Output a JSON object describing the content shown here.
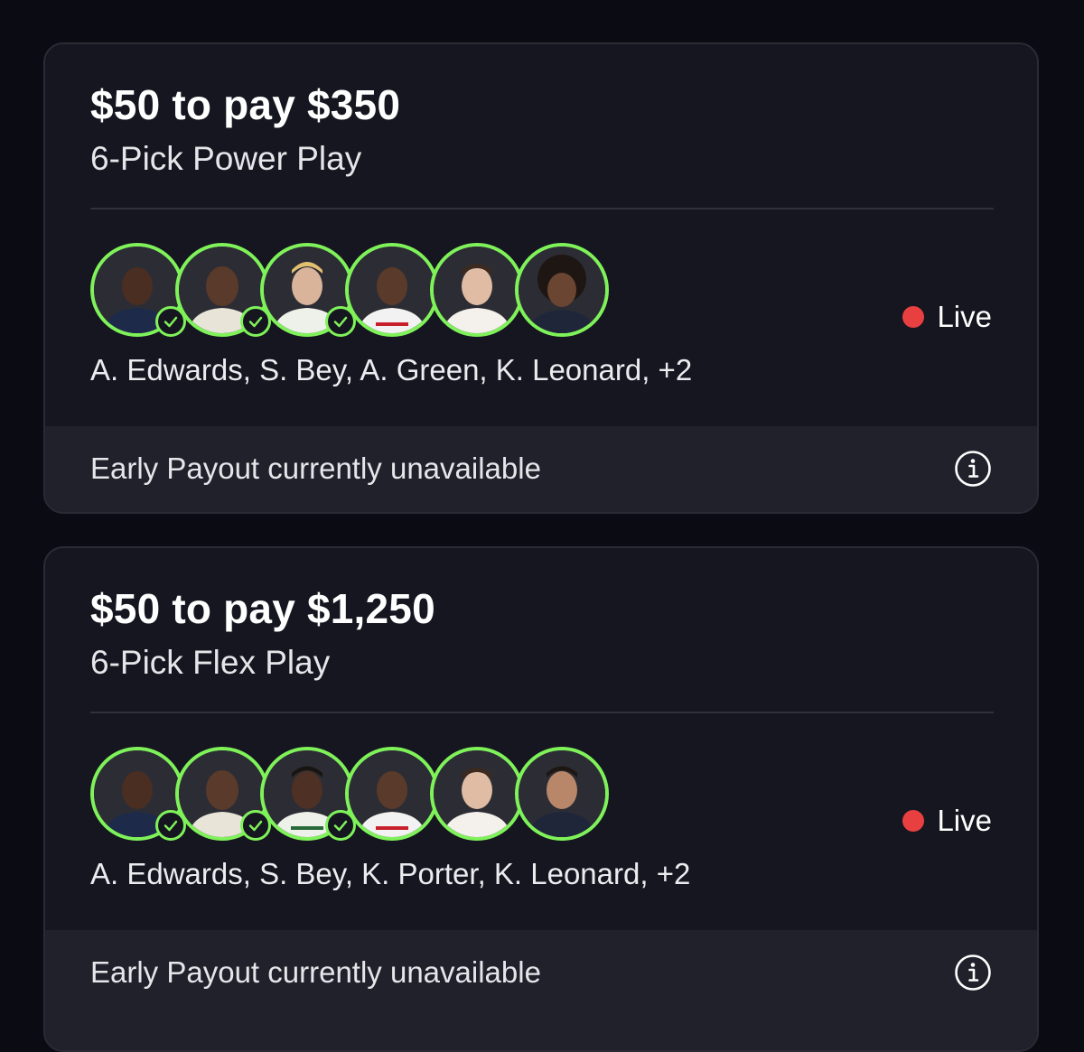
{
  "colors": {
    "background": "#0b0c13",
    "card": "#15161f",
    "accent_green": "#7ff25a",
    "live_red": "#e84040"
  },
  "entries": [
    {
      "title": "$50 to pay $350",
      "subtitle": "6-Pick Power Play",
      "status": "Live",
      "players_summary": "A. Edwards, S. Bey, A. Green, K. Leonard, +2",
      "footer_text": "Early Payout currently unavailable",
      "avatars": [
        {
          "icon": "player-avatar",
          "checked": true
        },
        {
          "icon": "player-avatar",
          "checked": true
        },
        {
          "icon": "player-avatar",
          "checked": true
        },
        {
          "icon": "player-avatar",
          "checked": false
        },
        {
          "icon": "player-avatar",
          "checked": false
        },
        {
          "icon": "player-avatar",
          "checked": false
        }
      ]
    },
    {
      "title": "$50 to pay $1,250",
      "subtitle": "6-Pick Flex Play",
      "status": "Live",
      "players_summary": "A. Edwards, S. Bey, K. Porter, K. Leonard, +2",
      "footer_text": "Early Payout currently unavailable",
      "avatars": [
        {
          "icon": "player-avatar",
          "checked": true
        },
        {
          "icon": "player-avatar",
          "checked": true
        },
        {
          "icon": "player-avatar",
          "checked": true
        },
        {
          "icon": "player-avatar",
          "checked": false
        },
        {
          "icon": "player-avatar",
          "checked": false
        },
        {
          "icon": "player-avatar",
          "checked": false
        }
      ]
    }
  ]
}
